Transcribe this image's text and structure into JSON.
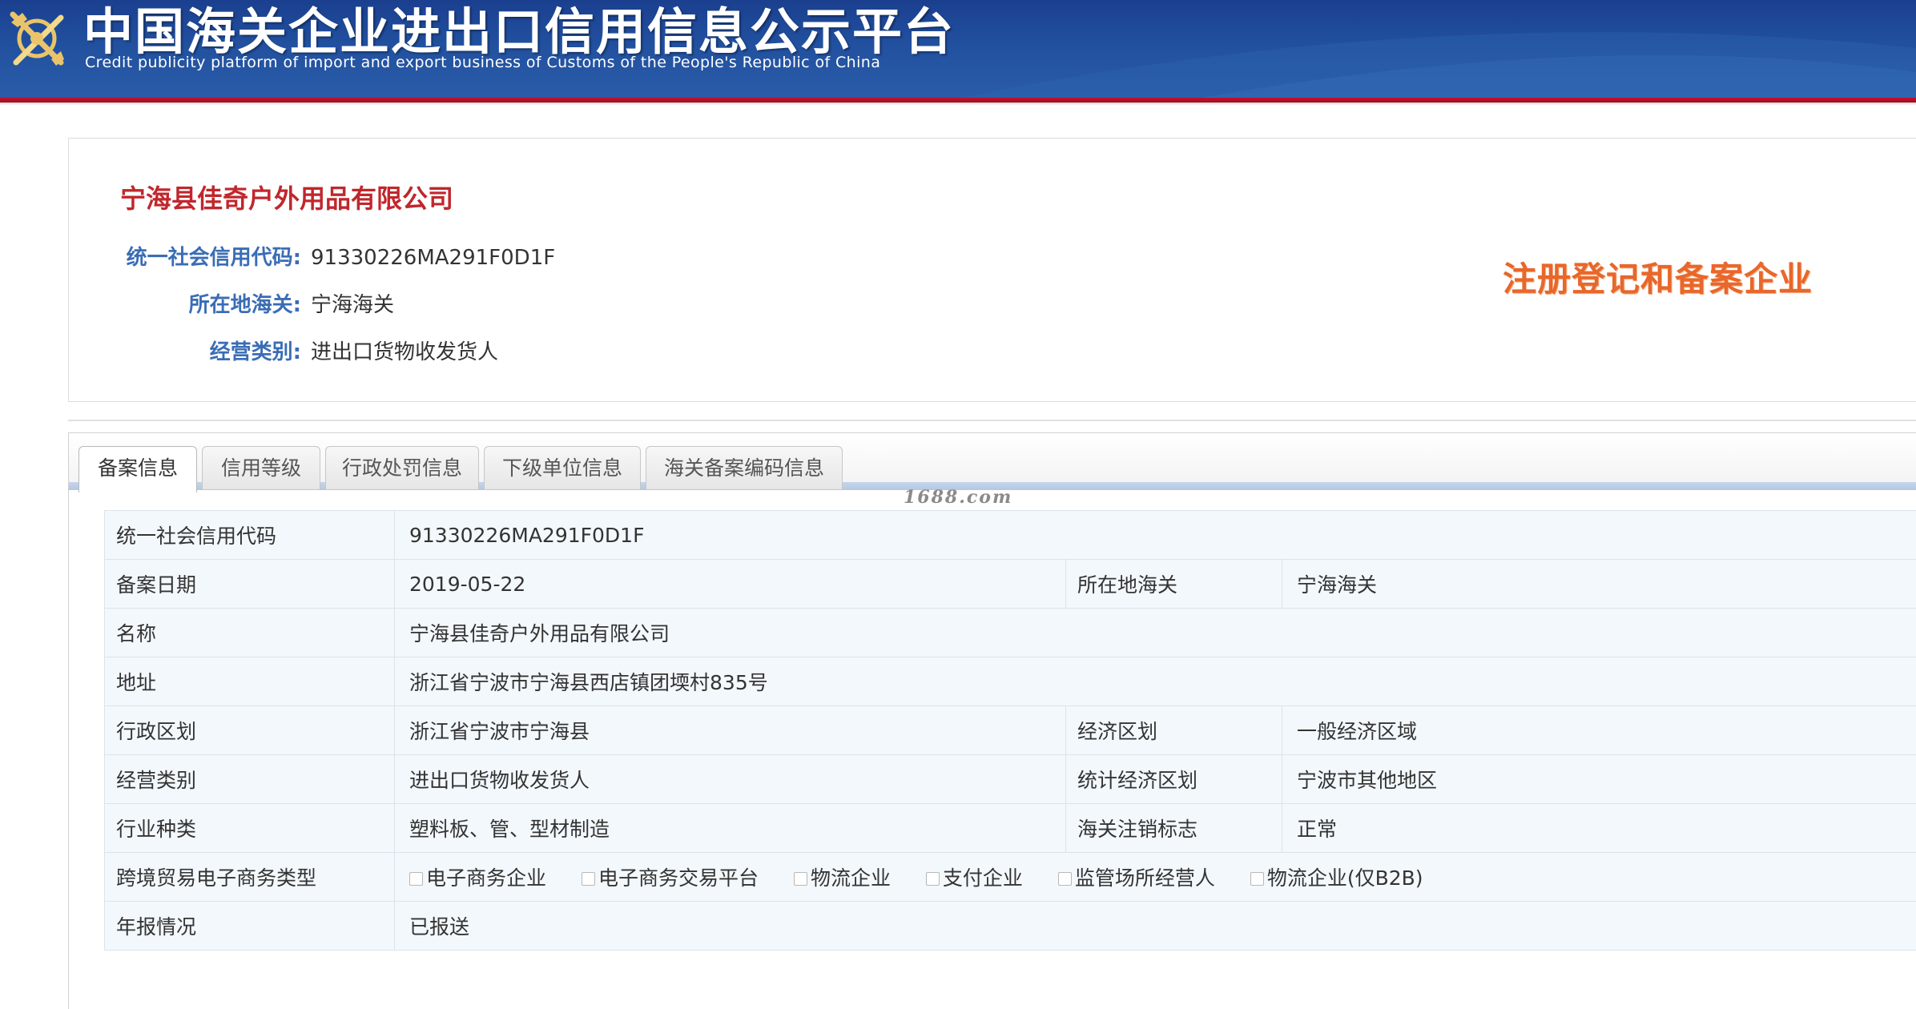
{
  "header": {
    "title": "中国海关企业进出口信用信息公示平台",
    "subtitle": "Credit publicity platform of import and export business of Customs of the People's Republic of China",
    "colors": {
      "banner": "#21509f",
      "accent_line": "#c8102e"
    }
  },
  "company": {
    "name": "宁海县佳奇户外用品有限公司",
    "credit_code_label": "统一社会信用代码:",
    "credit_code": "91330226MA291F0D1F",
    "customs_label": "所在地海关:",
    "customs": "宁海海关",
    "business_type_label": "经营类别:",
    "business_type": "进出口货物收发货人",
    "status_stamp": "注册登记和备案企业"
  },
  "tabs": [
    {
      "label": "备案信息",
      "active": true
    },
    {
      "label": "信用等级",
      "active": false
    },
    {
      "label": "行政处罚信息",
      "active": false
    },
    {
      "label": "下级单位信息",
      "active": false
    },
    {
      "label": "海关备案编码信息",
      "active": false
    }
  ],
  "watermark": "1688.com",
  "record": {
    "credit_code_label": "统一社会信用代码",
    "credit_code": "91330226MA291F0D1F",
    "record_date_label": "备案日期",
    "record_date": "2019-05-22",
    "customs_label": "所在地海关",
    "customs": "宁海海关",
    "name_label": "名称",
    "name": "宁海县佳奇户外用品有限公司",
    "address_label": "地址",
    "address": "浙江省宁波市宁海县西店镇团堧村835号",
    "admin_region_label": "行政区划",
    "admin_region": "浙江省宁波市宁海县",
    "econ_region_label": "经济区划",
    "econ_region": "一般经济区域",
    "business_type_label": "经营类别",
    "business_type": "进出口货物收发货人",
    "stat_region_label": "统计经济区划",
    "stat_region": "宁波市其他地区",
    "industry_label": "行业种类",
    "industry": "塑料板、管、型材制造",
    "cancel_flag_label": "海关注销标志",
    "cancel_flag": "正常",
    "ecommerce_label": "跨境贸易电子商务类型",
    "ecommerce_options": [
      {
        "label": "电子商务企业",
        "checked": false
      },
      {
        "label": "电子商务交易平台",
        "checked": false
      },
      {
        "label": "物流企业",
        "checked": false
      },
      {
        "label": "支付企业",
        "checked": false
      },
      {
        "label": "监管场所经营人",
        "checked": false
      },
      {
        "label": "物流企业(仅B2B)",
        "checked": false
      }
    ],
    "annual_report_label": "年报情况",
    "annual_report": "已报送"
  }
}
